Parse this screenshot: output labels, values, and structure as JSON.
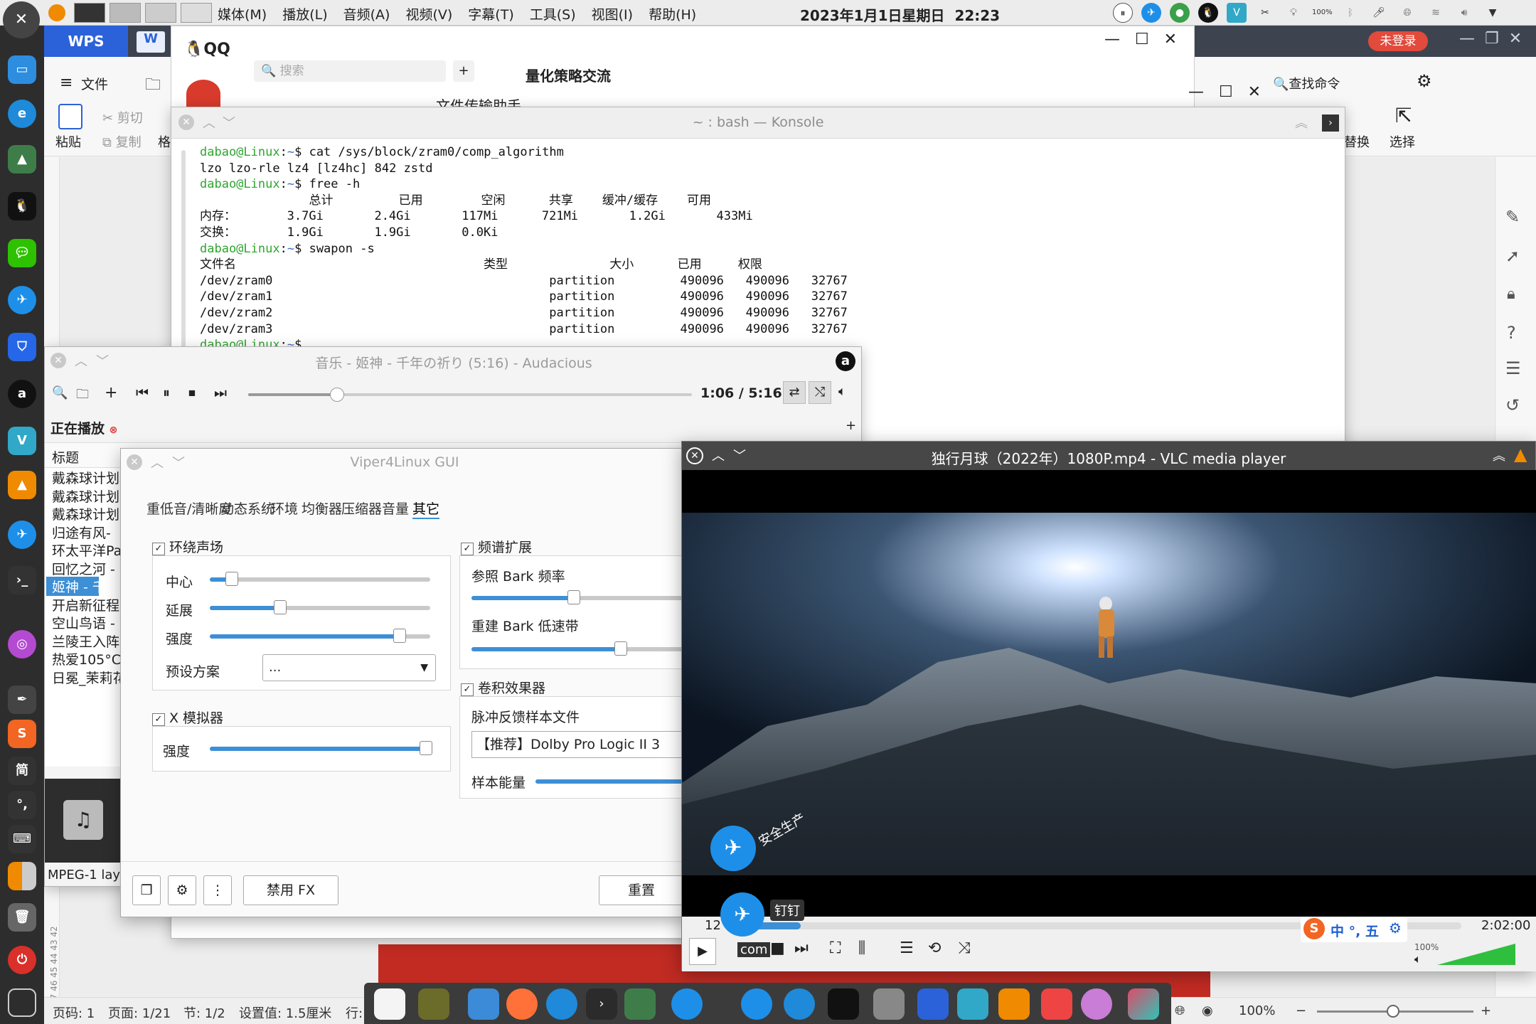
{
  "topbar": {
    "menus": [
      "媒体(M)",
      "播放(L)",
      "音频(A)",
      "视频(V)",
      "字幕(T)",
      "工具(S)",
      "视图(I)",
      "帮助(H)"
    ],
    "datetime": "2023年1月1日星期日",
    "time": "22:23",
    "battery_label": "100%"
  },
  "wps": {
    "tab_label": "WPS",
    "file_menu": "文件",
    "paste": "粘贴",
    "cut": "剪切",
    "copy": "复制",
    "format_short": "格",
    "find_command": "查找命令",
    "replace": "替换",
    "select": "选择",
    "login_badge": "未登录",
    "ruler_digits": "47 46 45 44 43 42",
    "status": {
      "page_code": "页码: 1",
      "page": "页面: 1/21",
      "section": "节: 1/2",
      "setting": "设置值: 1.5厘米",
      "row": "行:",
      "zoom": "100%"
    }
  },
  "qq": {
    "logo": "QQ",
    "search_placeholder": "搜索",
    "chat_title": "量化策略交流",
    "file_helper": "文件传输助手"
  },
  "konsole": {
    "title": "~ : bash — Konsole",
    "lines": [
      {
        "prompt": "dabao@Linux",
        "path": "~",
        "cmd": "cat /sys/block/zram0/comp_algorithm"
      },
      {
        "out": "lzo lzo-rle lz4 [lz4hc] 842 zstd"
      },
      {
        "prompt": "dabao@Linux",
        "path": "~",
        "cmd": "free -h"
      },
      {
        "out": "               总计         已用        空闲      共享    缓冲/缓存    可用"
      },
      {
        "out": "内存：       3.7Gi       2.4Gi       117Mi      721Mi       1.2Gi       433Mi"
      },
      {
        "out": "交换：       1.9Gi       1.9Gi       0.0Ki"
      },
      {
        "prompt": "dabao@Linux",
        "path": "~",
        "cmd": "swapon -s"
      },
      {
        "out": "文件名                                  类型              大小      已用     权限"
      },
      {
        "out": "/dev/zram0                                      partition         490096   490096   32767"
      },
      {
        "out": "/dev/zram1                                      partition         490096   490096   32767"
      },
      {
        "out": "/dev/zram2                                      partition         490096   490096   32767"
      },
      {
        "out": "/dev/zram3                                      partition         490096   490096   32767"
      },
      {
        "prompt": "dabao@Linux",
        "path": "~",
        "cmd": ""
      }
    ]
  },
  "audacious": {
    "title": "音乐 - 姬神 - 千年の祈り (5:16) - Audacious",
    "time": "1:06 / 5:16",
    "progress_fraction": 0.2,
    "now_playing_tab": "正在播放",
    "column_title": "标题",
    "playlist": [
      "戴森球计划",
      "戴森球计划",
      "戴森球计划",
      "归途有风-",
      "环太平洋Pa",
      "回忆之河 -",
      "姬神 - 千年",
      "开启新征程",
      "空山鸟语 -",
      "兰陵王入阵",
      "热爱105°C",
      "日冕_茉莉花"
    ],
    "selected_index": 6,
    "status": "MPEG-1 lay"
  },
  "viper": {
    "title": "Viper4Linux GUI",
    "tabs": [
      "重低音/清晰度",
      "动态系统",
      "环境",
      "均衡器",
      "压缩器",
      "音量",
      "其它"
    ],
    "active_tab": "其它",
    "surround": {
      "label": "环绕声场",
      "center": "中心",
      "center_value": 0.1,
      "delay": "延展",
      "delay_value": 0.32,
      "strength": "强度",
      "strength_value": 0.86,
      "preset_label": "预设方案",
      "preset_value": "..."
    },
    "x_sim": {
      "label": "X 模拟器",
      "strength": "强度",
      "strength_value": 0.98
    },
    "spectrum": {
      "label": "频谱扩展",
      "bark_ref": "参照 Bark 频率",
      "bark_ref_value": 0.48,
      "bark_rebuild": "重建 Bark 低速带",
      "bark_rebuild_value": 0.7
    },
    "convolver": {
      "label": "卷积效果器",
      "irs_label": "脉冲反馈样本文件",
      "irs_value": "【推荐】Dolby Pro Logic II 3",
      "energy_label": "样本能量"
    },
    "disable_fx": "禁用 FX",
    "reset": "重置"
  },
  "vlc": {
    "title": "独行月球（2022年）1080P.mp4 - VLC media player",
    "elapsed_partial": "12",
    "duration": "2:02:00",
    "progress_fraction": 0.1,
    "volume_label": "100%",
    "volume_fraction": 1.0,
    "overlay_tooltip": "钉钉",
    "overlay_badge": "安全生产",
    "overlay_com": "com",
    "ime_text": "中 °, 五"
  }
}
